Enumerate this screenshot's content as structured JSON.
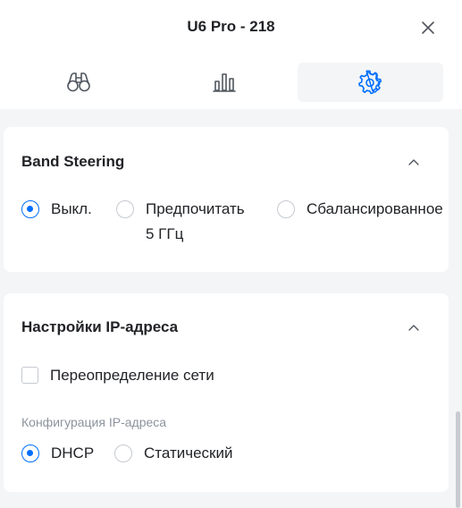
{
  "header": {
    "title": "U6 Pro - 218",
    "close_icon": "close-icon"
  },
  "tabs": [
    {
      "icon": "binoculars-icon",
      "active": false
    },
    {
      "icon": "bar-chart-icon",
      "active": false
    },
    {
      "icon": "gear-icon",
      "active": true
    }
  ],
  "band_steering": {
    "title": "Band Steering",
    "options": [
      {
        "label": "Выкл.",
        "selected": true
      },
      {
        "label_line1": "Предпочитать",
        "label_line2": "5 ГГц",
        "selected": false
      },
      {
        "label": "Сбалансированное",
        "selected": false
      }
    ]
  },
  "ip_settings": {
    "title": "Настройки IP-адреса",
    "override_label": "Переопределение сети",
    "override_checked": false,
    "config_label": "Конфигурация IP-адреса",
    "options": [
      {
        "label": "DHCP",
        "selected": true
      },
      {
        "label": "Статический",
        "selected": false
      }
    ]
  },
  "colors": {
    "accent": "#006fff",
    "text": "#212327",
    "muted": "#8c939d",
    "background": "#f4f5f6"
  }
}
